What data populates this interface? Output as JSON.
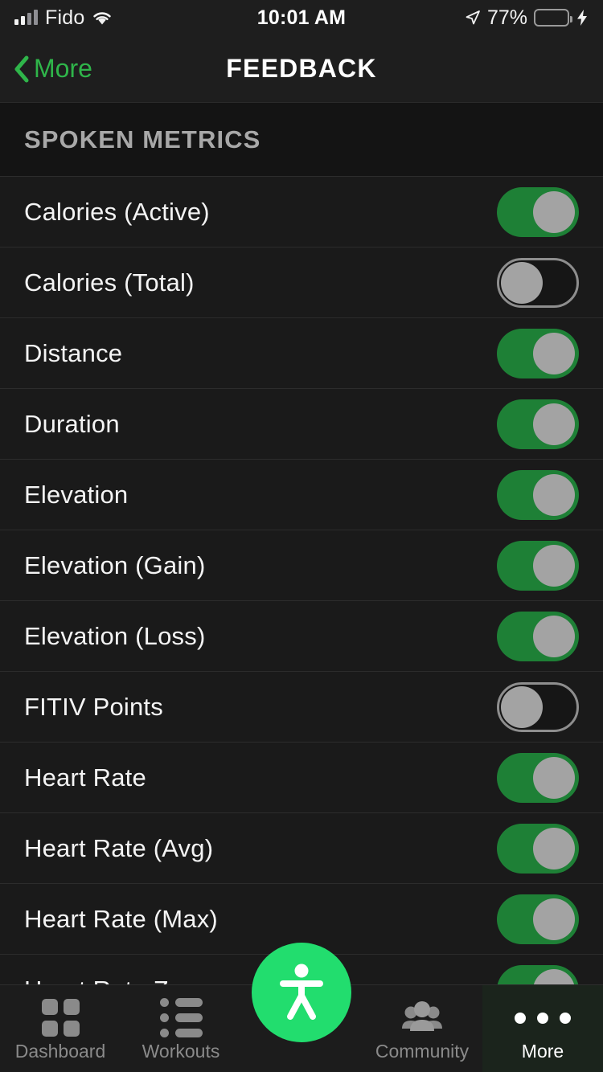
{
  "status_bar": {
    "carrier": "Fido",
    "signal_icon": "cellular-signal-icon",
    "signal_bars_active": 2,
    "signal_bars_total": 4,
    "wifi_icon": "wifi-icon",
    "time": "10:01 AM",
    "location_icon": "location-arrow-icon",
    "battery_percent": "77%",
    "battery_level": 77,
    "battery_icon": "battery-icon",
    "charging_icon": "lightning-bolt-icon",
    "battery_color": "#4cd964"
  },
  "nav": {
    "back_label": "More",
    "back_icon": "chevron-left-icon",
    "title": "FEEDBACK",
    "accent_color": "#2fb54a"
  },
  "section": {
    "header": "SPOKEN METRICS"
  },
  "rows": [
    {
      "label": "Calories (Active)",
      "enabled": true
    },
    {
      "label": "Calories (Total)",
      "enabled": false
    },
    {
      "label": "Distance",
      "enabled": true
    },
    {
      "label": "Duration",
      "enabled": true
    },
    {
      "label": "Elevation",
      "enabled": true
    },
    {
      "label": "Elevation (Gain)",
      "enabled": true
    },
    {
      "label": "Elevation (Loss)",
      "enabled": true
    },
    {
      "label": "FITIV Points",
      "enabled": false
    },
    {
      "label": "Heart Rate",
      "enabled": true
    },
    {
      "label": "Heart Rate (Avg)",
      "enabled": true
    },
    {
      "label": "Heart Rate (Max)",
      "enabled": true
    },
    {
      "label": "Heart Rate Zone",
      "enabled": true
    }
  ],
  "toggle_colors": {
    "on_track": "#1e8036",
    "off_track": "#161616",
    "off_border": "#8e8e8e",
    "knob": "#a3a3a3"
  },
  "tab_bar": {
    "items": [
      {
        "label": "Dashboard",
        "icon": "grid-icon",
        "active": false
      },
      {
        "label": "Workouts",
        "icon": "list-icon",
        "active": false
      },
      {
        "label": "Community",
        "icon": "people-group-icon",
        "active": false
      },
      {
        "label": "More",
        "icon": "ellipsis-icon",
        "active": true
      }
    ],
    "fab": {
      "icon": "accessibility-person-icon",
      "color": "#22dd6e"
    }
  }
}
